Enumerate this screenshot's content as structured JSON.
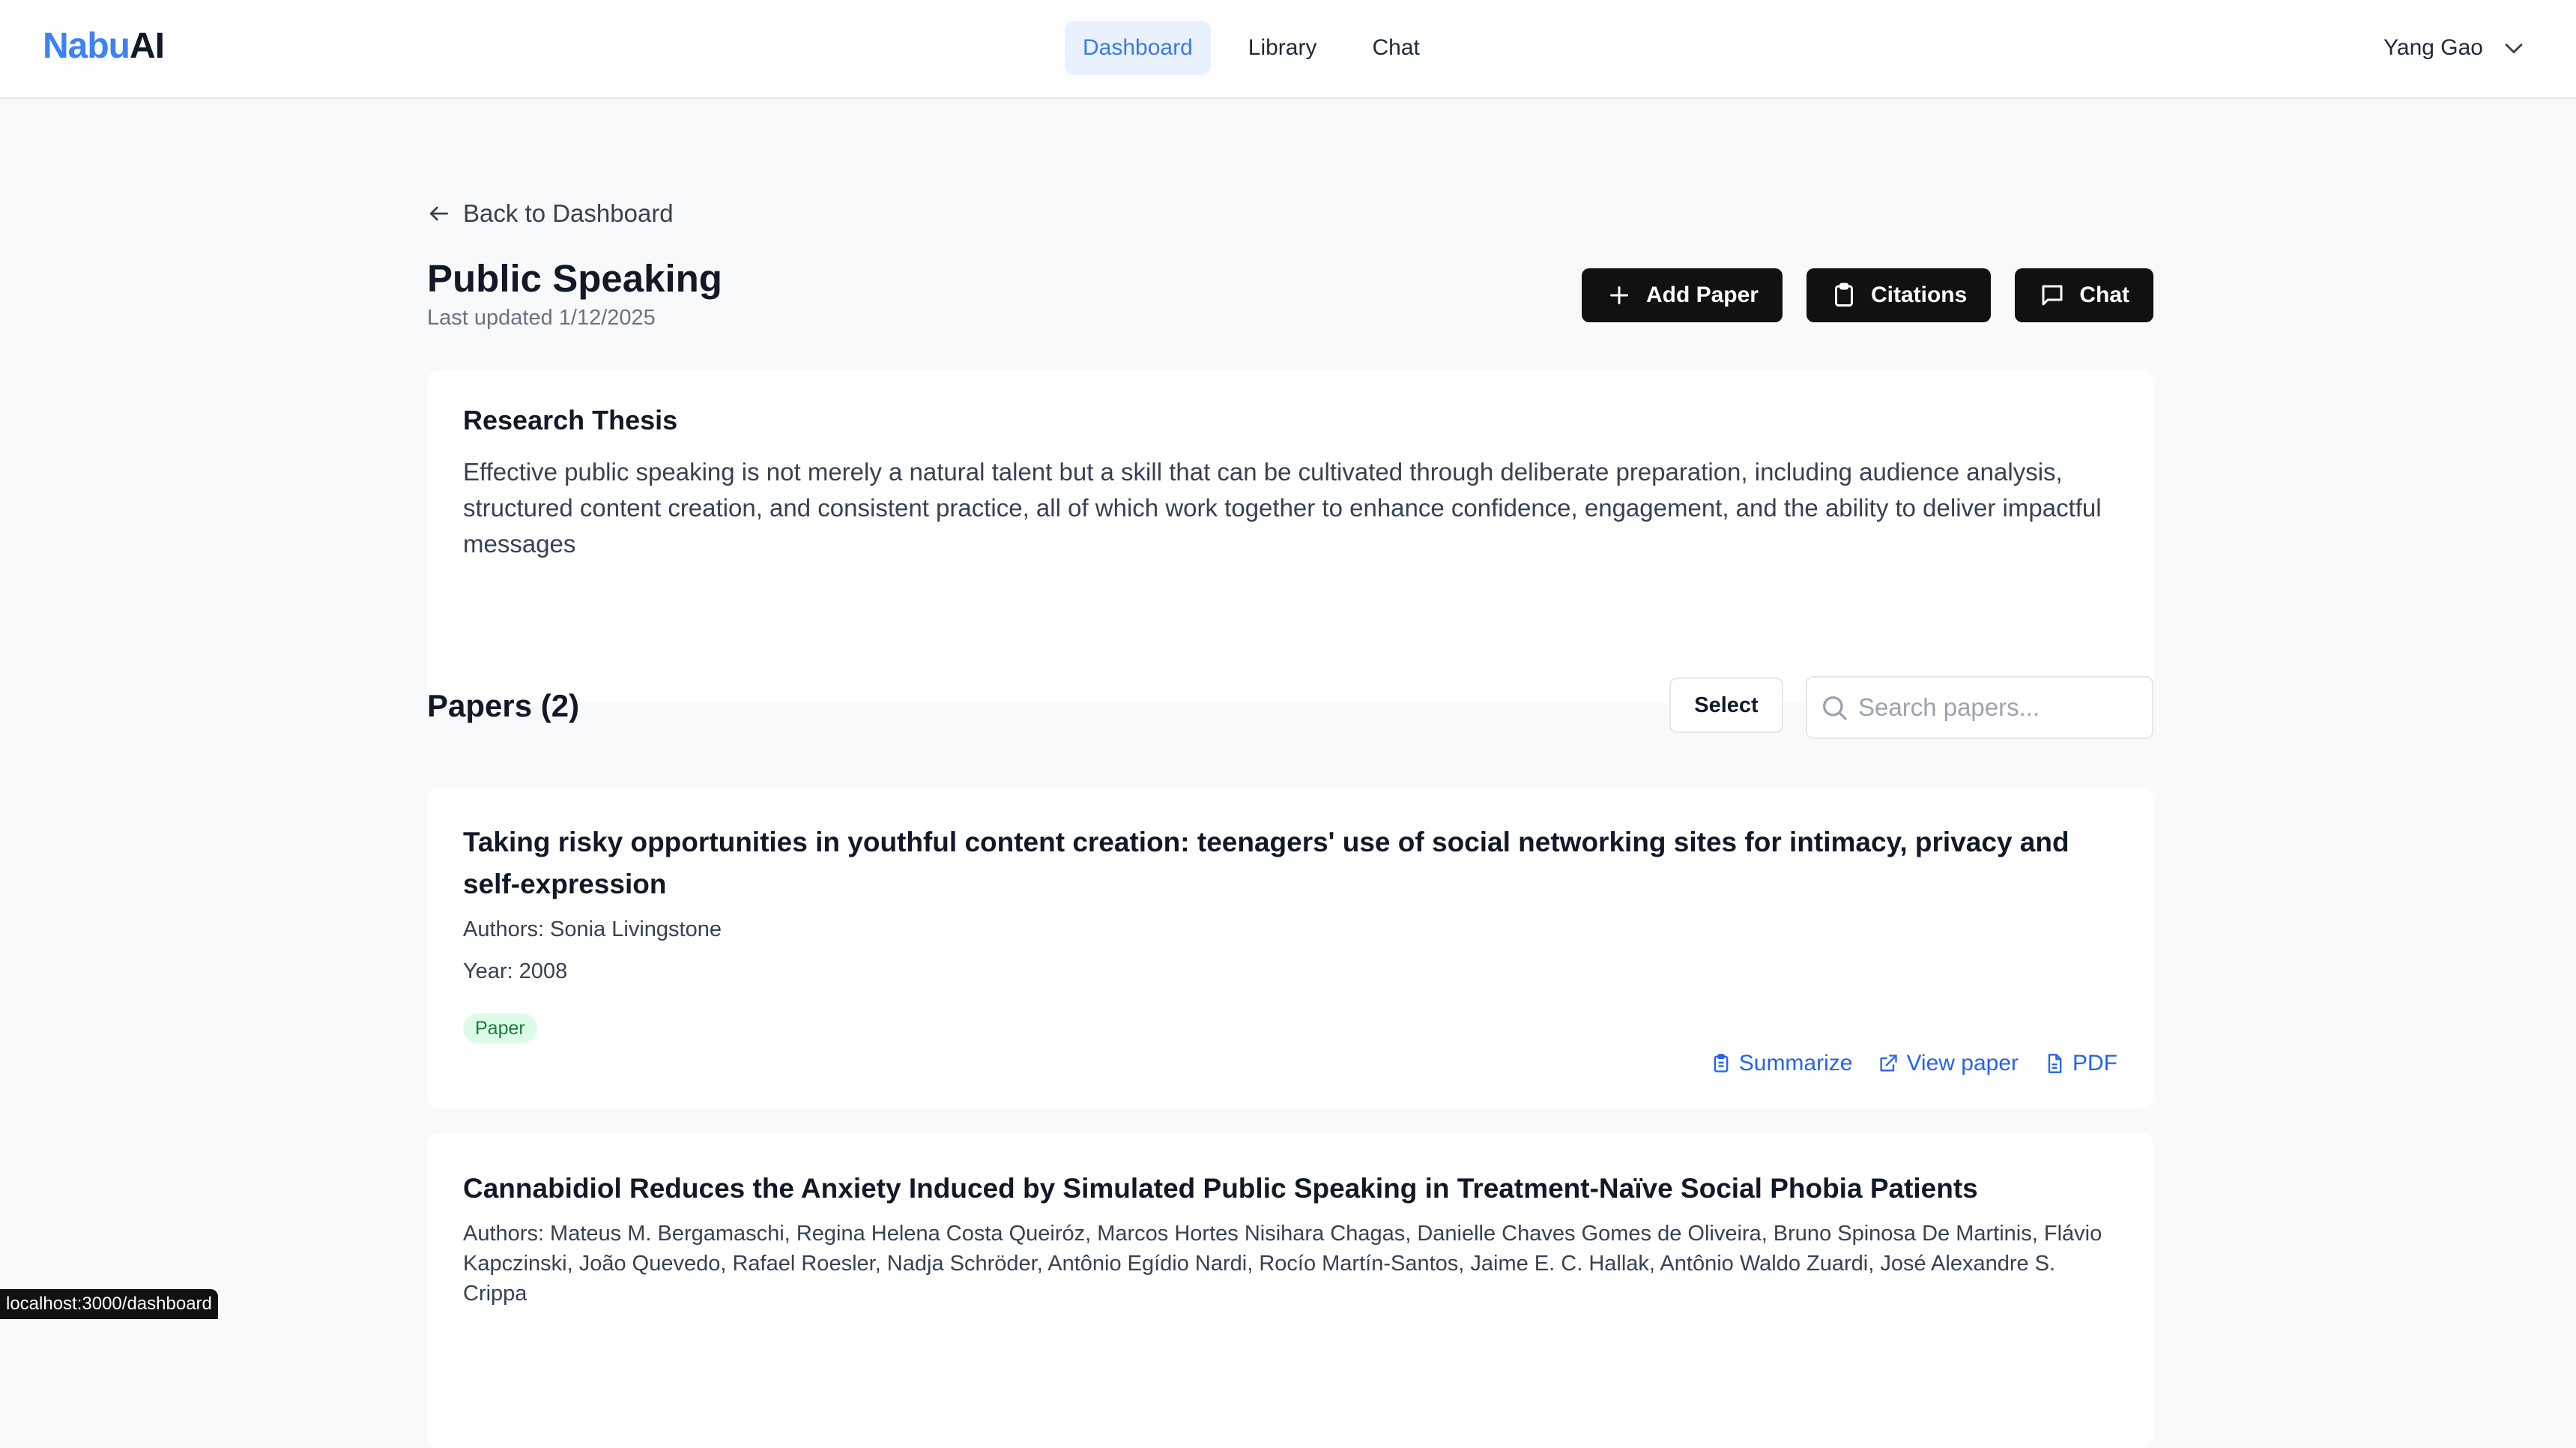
{
  "app": {
    "logo_part1": "Nabu",
    "logo_part2": "AI"
  },
  "nav": {
    "items": [
      "Dashboard",
      "Library",
      "Chat"
    ],
    "active": "Dashboard"
  },
  "user": {
    "name": "Yang Gao"
  },
  "page": {
    "back_label": "Back to Dashboard",
    "title": "Public Speaking",
    "last_updated": "Last updated 1/12/2025",
    "actions": {
      "add_paper": "Add Paper",
      "citations": "Citations",
      "chat": "Chat"
    }
  },
  "thesis": {
    "heading": "Research Thesis",
    "text": "Effective public speaking is not merely a natural talent but a skill that can be cultivated through deliberate preparation, including audience analysis, structured content creation, and consistent practice, all of which work together to enhance confidence, engagement, and the ability to deliver impactful messages"
  },
  "papers": {
    "heading": "Papers (2)",
    "select_label": "Select",
    "search_placeholder": "Search papers...",
    "items": [
      {
        "title": "Taking risky opportunities in youthful content creation: teenagers' use of social networking sites for intimacy, privacy and self-expression",
        "authors": "Authors: Sonia Livingstone",
        "year": "Year: 2008",
        "tag": "Paper",
        "links": {
          "summarize": "Summarize",
          "view": "View paper",
          "pdf": "PDF"
        }
      },
      {
        "title": "Cannabidiol Reduces the Anxiety Induced by Simulated Public Speaking in Treatment-Naïve Social Phobia Patients",
        "authors": "Authors: Mateus M. Bergamaschi, Regina Helena Costa Queiróz, Marcos Hortes Nisihara Chagas, Danielle Chaves Gomes de Oliveira, Bruno Spinosa De Martinis, Flávio Kapczinski, João Quevedo, Rafael Roesler, Nadja Schröder, Antônio Egídio Nardi, Rocío Martín-Santos, Jaime E. C. Hallak, Antônio Waldo Zuardi, José Alexandre S. Crippa"
      }
    ]
  },
  "statusbar": {
    "url": "localhost:3000/dashboard"
  },
  "colors": {
    "accent": "#3b82f6",
    "link": "#2563eb",
    "tag_bg": "#dcfce7",
    "tag_text": "#15803d",
    "button_dark": "#111111"
  }
}
